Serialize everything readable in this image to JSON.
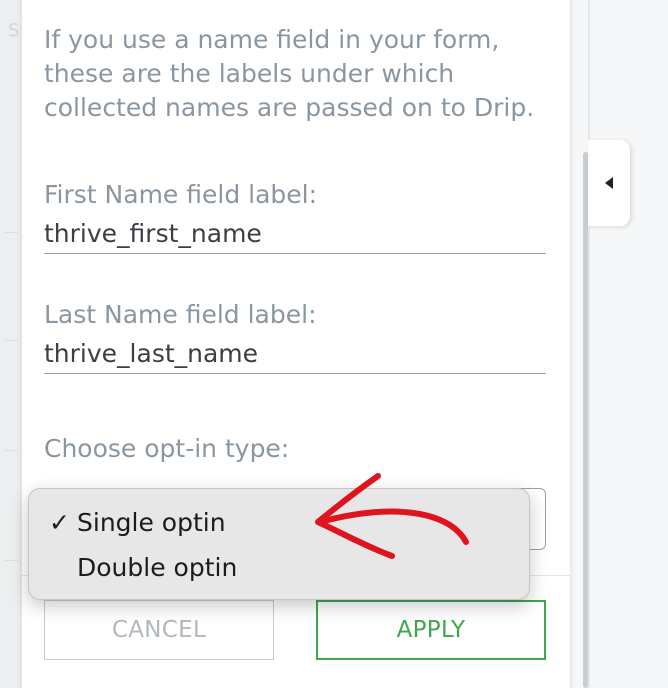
{
  "panel": {
    "help_text": "If you use a name field in your form, these are the labels under which collected names are passed on to Drip.",
    "first_name_label": "First Name field label:",
    "first_name_value": "thrive_first_name",
    "last_name_label": "Last Name field label:",
    "last_name_value": "thrive_last_name",
    "optin_label": "Choose opt-in type:"
  },
  "optin_menu": {
    "items": [
      {
        "label": "Single optin",
        "checked": true,
        "check_mark": "✓"
      },
      {
        "label": "Double optin",
        "checked": false
      }
    ]
  },
  "buttons": {
    "cancel": "CANCEL",
    "apply": "APPLY"
  },
  "colors": {
    "apply_accent": "#3fa74d",
    "annotation_arrow": "#e0141e"
  },
  "icons": {
    "collapse": "caret-left-icon",
    "annotation": "red-arrow-icon"
  }
}
